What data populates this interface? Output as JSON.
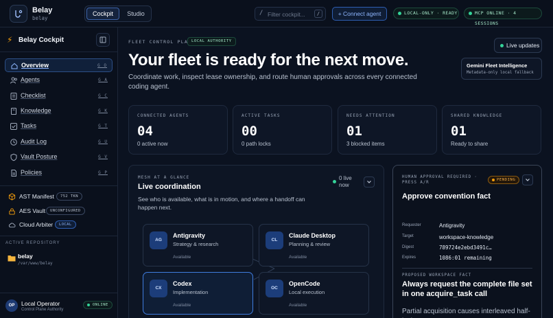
{
  "brand": {
    "name": "Belay",
    "sub": "belay"
  },
  "topbar": {
    "tabs": [
      {
        "label": "Cockpit",
        "active": true
      },
      {
        "label": "Studio",
        "active": false
      }
    ],
    "filter": {
      "prefix": "/",
      "placeholder": "Filter cockpit...",
      "shortcut": "/"
    },
    "connect_label": "+ Connect agent",
    "status_local": "LOCAL-ONLY · READY",
    "status_mcp": "MCP ONLINE · 4 SESSIONS"
  },
  "sidebar": {
    "title": "Belay Cockpit",
    "nav": [
      {
        "label": "Overview",
        "key": "G O",
        "icon": "home-icon",
        "active": true
      },
      {
        "label": "Agents",
        "key": "G A",
        "icon": "users-icon",
        "active": false
      },
      {
        "label": "Checklist",
        "key": "G C",
        "icon": "checklist-icon",
        "active": false
      },
      {
        "label": "Knowledge",
        "key": "G K",
        "icon": "book-icon",
        "active": false
      },
      {
        "label": "Tasks",
        "key": "G T",
        "icon": "tasks-icon",
        "active": false
      },
      {
        "label": "Audit Log",
        "key": "G U",
        "icon": "history-icon",
        "active": false
      },
      {
        "label": "Vault Posture",
        "key": "G V",
        "icon": "shield-icon",
        "active": false
      },
      {
        "label": "Policies",
        "key": "G P",
        "icon": "document-icon",
        "active": false
      }
    ],
    "tools": [
      {
        "label": "AST Manifest",
        "badge": "752 TKN",
        "icon": "cube-icon"
      },
      {
        "label": "AES Vault",
        "badge": "UNCONFIGURED",
        "icon": "lock-icon"
      },
      {
        "label": "Cloud Arbiter",
        "badge": "LOCAL",
        "icon": "cloud-icon"
      }
    ],
    "repo_section": "ACTIVE REPOSITORY",
    "repo": {
      "name": "belay",
      "path": "/var/www/belay"
    },
    "operator": {
      "initials": "OP",
      "name": "Local Operator",
      "role": "Control Plane Authority",
      "status": "ONLINE"
    }
  },
  "hero": {
    "eyebrow": "FLEET CONTROL PLANE",
    "authority": "LOCAL AUTHORITY",
    "title": "Your fleet is ready for the next move.",
    "subtitle": "Coordinate work, inspect lease ownership, and route human approvals across every connected coding agent.",
    "live_label": "Live updates",
    "gemini_title": "Gemini Fleet Intelligence",
    "gemini_sub": "Metadata-only local fallback"
  },
  "stats": [
    {
      "label": "CONNECTED AGENTS",
      "value": "04",
      "sub": "0 active now"
    },
    {
      "label": "ACTIVE TASKS",
      "value": "00",
      "sub": "0 path locks"
    },
    {
      "label": "NEEDS ATTENTION",
      "value": "01",
      "sub": "3 blocked items"
    },
    {
      "label": "SHARED KNOWLEDGE",
      "value": "01",
      "sub": "Ready to share"
    }
  ],
  "mesh": {
    "eyebrow": "MESH AT A GLANCE",
    "title": "Live coordination",
    "desc": "See who is available, what is in motion, and where a handoff can happen next.",
    "live_line1": "0 live",
    "live_line2": "now",
    "agents": [
      {
        "initials": "AG",
        "name": "Antigravity",
        "role": "Strategy & research",
        "status": "Available"
      },
      {
        "initials": "CL",
        "name": "Claude Desktop",
        "role": "Planning & review",
        "status": "Available"
      },
      {
        "initials": "CX",
        "name": "Codex",
        "role": "Implementation",
        "status": "Available"
      },
      {
        "initials": "OC",
        "name": "OpenCode",
        "role": "Local execution",
        "status": "Available"
      }
    ]
  },
  "approval": {
    "eyebrow": "HUMAN APPROVAL REQUIRED · PRESS A/R",
    "status": "PENDING",
    "title": "Approve convention fact",
    "rows": [
      {
        "key": "Requester",
        "value": "Antigravity"
      },
      {
        "key": "Target",
        "value": "workspace-knowledge"
      },
      {
        "key": "Digest",
        "value": "789724e2ebd3491c…"
      },
      {
        "key": "Expires",
        "value": "1086:01 remaining"
      }
    ],
    "proposed_eyebrow": "PROPOSED WORKSPACE FACT",
    "proposed_text": "Always request the complete file set in one acquire_task call",
    "proposed_desc": "Partial acquisition causes interleaved half-locks"
  }
}
